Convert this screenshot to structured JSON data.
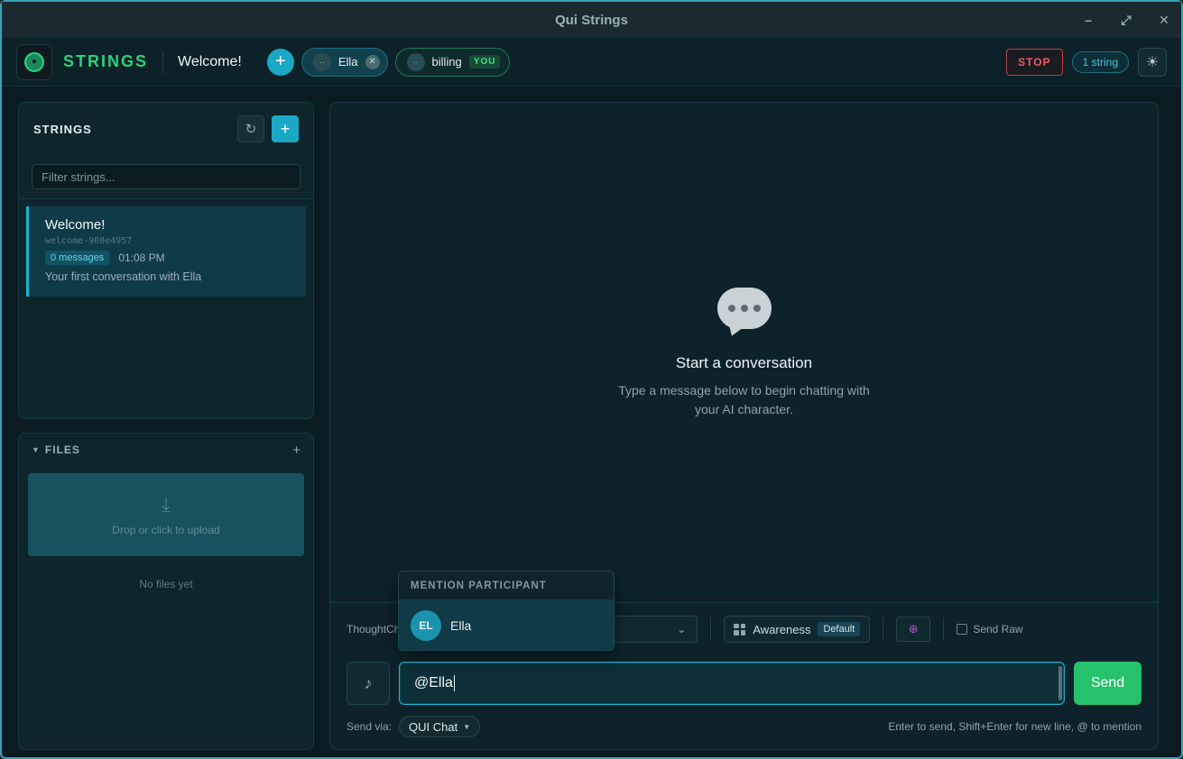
{
  "window": {
    "title": "Qui Strings"
  },
  "header": {
    "brand": "STRINGS",
    "string_title": "Welcome!",
    "add_label": "+",
    "participants": [
      {
        "name": "Ella",
        "avatar": "··"
      },
      {
        "name": "billing",
        "avatar": "··",
        "badge": "YOU"
      }
    ],
    "stop_label": "STOP",
    "string_count": "1 string"
  },
  "strings_panel": {
    "title": "STRINGS",
    "filter_placeholder": "Filter strings...",
    "items": [
      {
        "name": "Welcome!",
        "slug": "welcome-908e4957",
        "messages": "0 messages",
        "time": "01:08 PM",
        "description": "Your first conversation with Ella"
      }
    ]
  },
  "files_panel": {
    "title": "FILES",
    "drop_text": "Drop or click to upload",
    "empty_text": "No files yet"
  },
  "chat": {
    "empty_title": "Start a conversation",
    "empty_subtitle": "Type a message below to begin chatting with your AI character.",
    "thought_label": "ThoughtCh",
    "awareness_label": "Awareness",
    "awareness_badge": "Default",
    "send_raw_label": "Send Raw",
    "input_value": "@Ella",
    "send_label": "Send",
    "send_via_label": "Send via:",
    "send_via_value": "QUI Chat",
    "hint": "Enter to send, Shift+Enter for new line, @ to mention"
  },
  "mention_popup": {
    "header": "MENTION PARTICIPANT",
    "items": [
      {
        "initials": "EL",
        "name": "Ella"
      }
    ]
  },
  "colors": {
    "accent": "#1aa8c6",
    "brand_green": "#2bd27c",
    "send_green": "#25c26b",
    "stop_red": "#ef5b64"
  }
}
